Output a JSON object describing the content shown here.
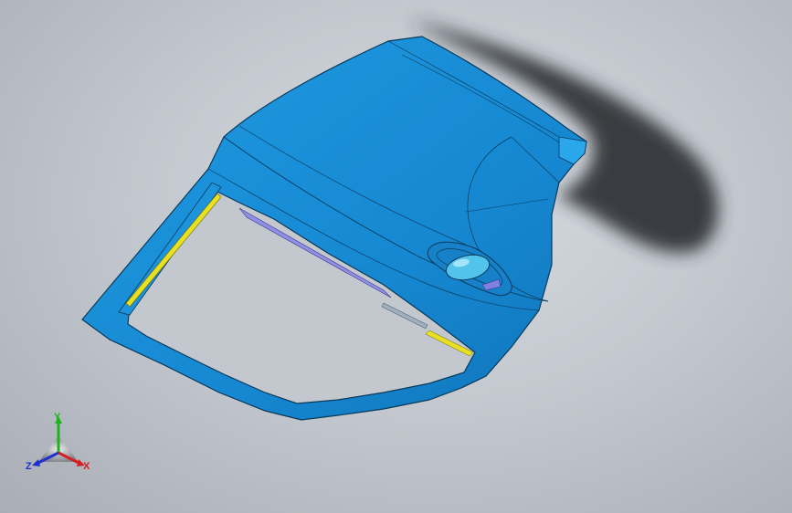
{
  "viewport": {
    "background": "gradient-grey",
    "model": {
      "name": "car-door-panel",
      "color": "#1a8fd8",
      "edge_color": "#0a3a5a",
      "accents": [
        "#e8e020",
        "#8f8fe8",
        "#52c4ec"
      ]
    }
  },
  "triad": {
    "x_label": "X",
    "y_label": "Y",
    "z_label": "Z",
    "x_color": "#d42020",
    "y_color": "#1db51d",
    "z_color": "#2030d0"
  }
}
